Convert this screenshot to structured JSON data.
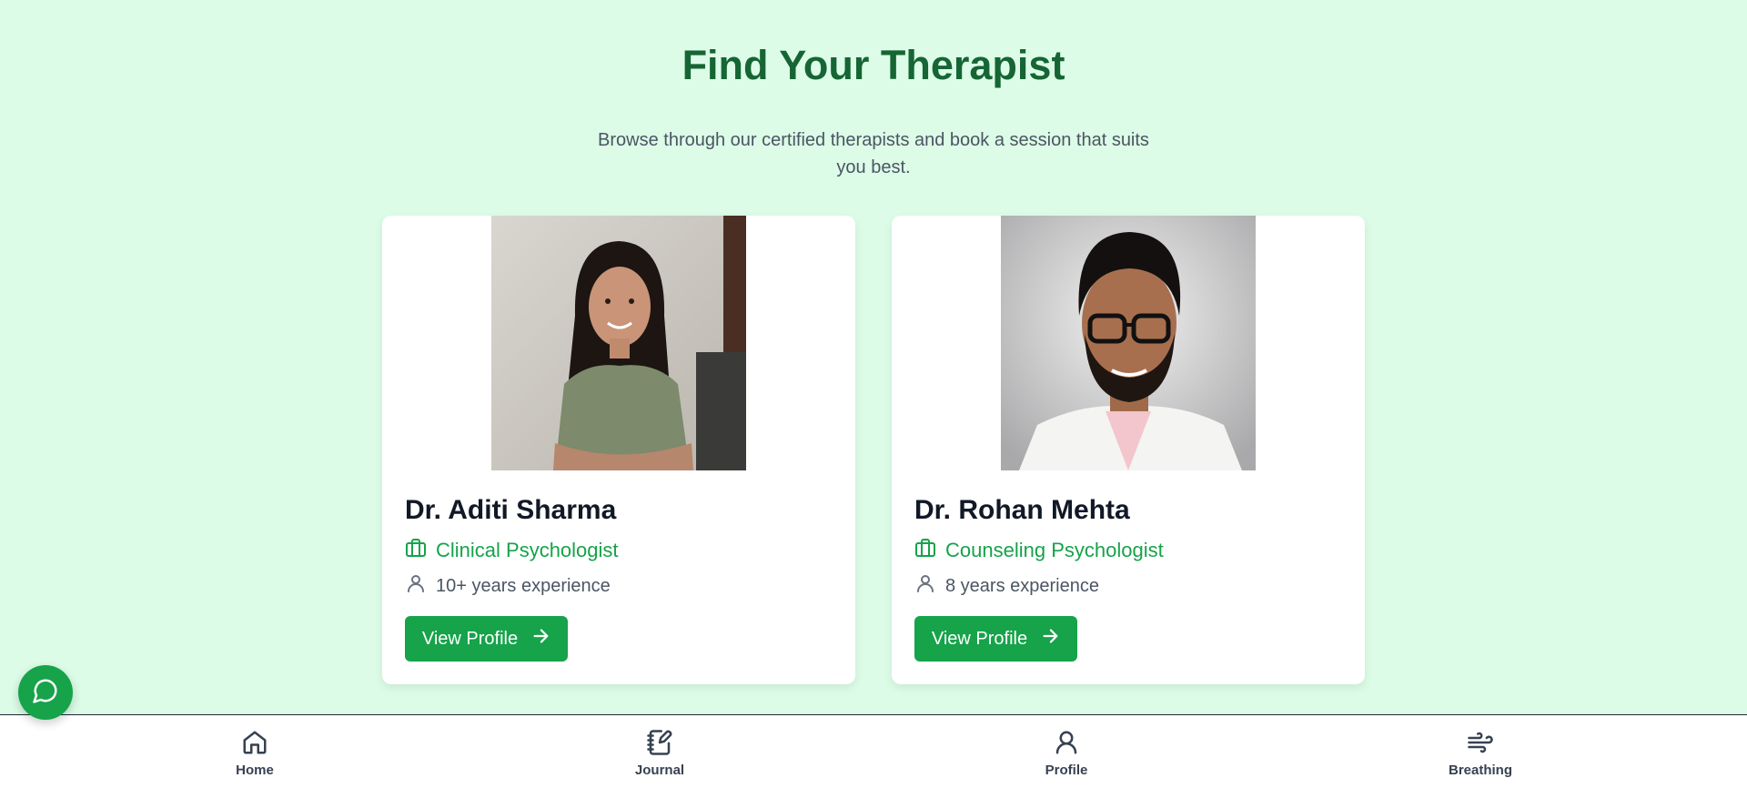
{
  "header": {
    "title": "Find Your Therapist",
    "subtitle": "Browse through our certified therapists and book a session that suits you best."
  },
  "therapists": [
    {
      "name": "Dr. Aditi Sharma",
      "specialty": "Clinical Psychologist",
      "experience": "10+ years experience",
      "button_label": "View Profile"
    },
    {
      "name": "Dr. Rohan Mehta",
      "specialty": "Counseling Psychologist",
      "experience": "8 years experience",
      "button_label": "View Profile"
    }
  ],
  "bottom_nav": {
    "items": [
      {
        "label": "Home",
        "icon": "home-icon"
      },
      {
        "label": "Journal",
        "icon": "journal-icon"
      },
      {
        "label": "Profile",
        "icon": "user-icon"
      },
      {
        "label": "Breathing",
        "icon": "wind-icon"
      }
    ]
  },
  "colors": {
    "background": "#dcfce7",
    "accent": "#16a34a",
    "title": "#166534"
  }
}
